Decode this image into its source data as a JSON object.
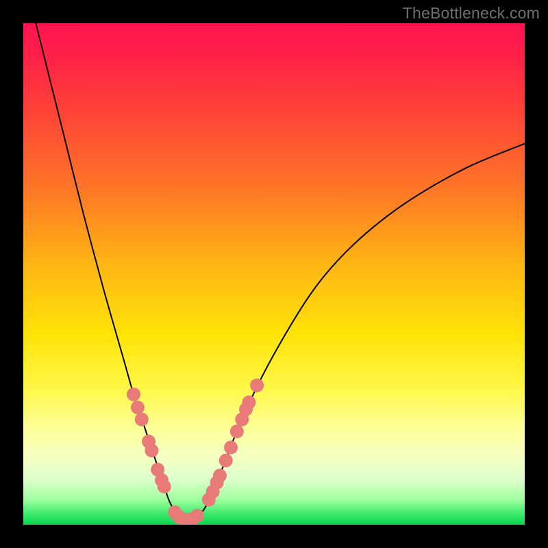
{
  "watermark": "TheBottleneck.com",
  "colors": {
    "dot_fill": "#e87a77",
    "dot_stroke": "#d55f5c",
    "curve_stroke": "#000000"
  },
  "chart_data": {
    "type": "line",
    "title": "",
    "xlabel": "",
    "ylabel": "",
    "xlim": [
      0,
      100
    ],
    "ylim": [
      0,
      100
    ],
    "series": [
      {
        "name": "bottleneck-curve",
        "x": [
          0,
          4,
          8,
          12,
          16,
          20,
          22,
          24,
          26,
          28,
          29,
          30,
          31,
          32,
          33,
          34,
          36,
          38,
          40,
          44,
          50,
          58,
          66,
          76,
          88,
          100
        ],
        "y": [
          110,
          94,
          78,
          62,
          47,
          33,
          26,
          20,
          14,
          8,
          5,
          3,
          1.5,
          1,
          1,
          1.3,
          3,
          7,
          12,
          22,
          34,
          47,
          56,
          64,
          71,
          76
        ]
      }
    ],
    "marker_clusters": [
      {
        "name": "left-cluster",
        "points": [
          {
            "x": 22.0,
            "y": 26.0
          },
          {
            "x": 22.8,
            "y": 23.4
          },
          {
            "x": 23.6,
            "y": 21.0
          },
          {
            "x": 25.0,
            "y": 16.6
          },
          {
            "x": 25.6,
            "y": 14.8
          },
          {
            "x": 26.8,
            "y": 11.0
          },
          {
            "x": 27.6,
            "y": 8.9
          },
          {
            "x": 28.1,
            "y": 7.6
          }
        ]
      },
      {
        "name": "trough-cluster",
        "points": [
          {
            "x": 30.2,
            "y": 2.5
          },
          {
            "x": 31.0,
            "y": 1.6
          },
          {
            "x": 32.0,
            "y": 1.0
          },
          {
            "x": 33.0,
            "y": 1.0
          },
          {
            "x": 33.8,
            "y": 1.2
          },
          {
            "x": 34.7,
            "y": 1.8
          }
        ]
      },
      {
        "name": "right-cluster",
        "points": [
          {
            "x": 37.0,
            "y": 5.0
          },
          {
            "x": 37.8,
            "y": 6.6
          },
          {
            "x": 38.6,
            "y": 8.4
          },
          {
            "x": 39.2,
            "y": 9.8
          },
          {
            "x": 40.4,
            "y": 12.8
          },
          {
            "x": 41.4,
            "y": 15.4
          },
          {
            "x": 42.6,
            "y": 18.6
          },
          {
            "x": 43.6,
            "y": 21.0
          },
          {
            "x": 44.4,
            "y": 23.0
          },
          {
            "x": 45.0,
            "y": 24.4
          },
          {
            "x": 46.6,
            "y": 27.8
          }
        ]
      }
    ]
  }
}
